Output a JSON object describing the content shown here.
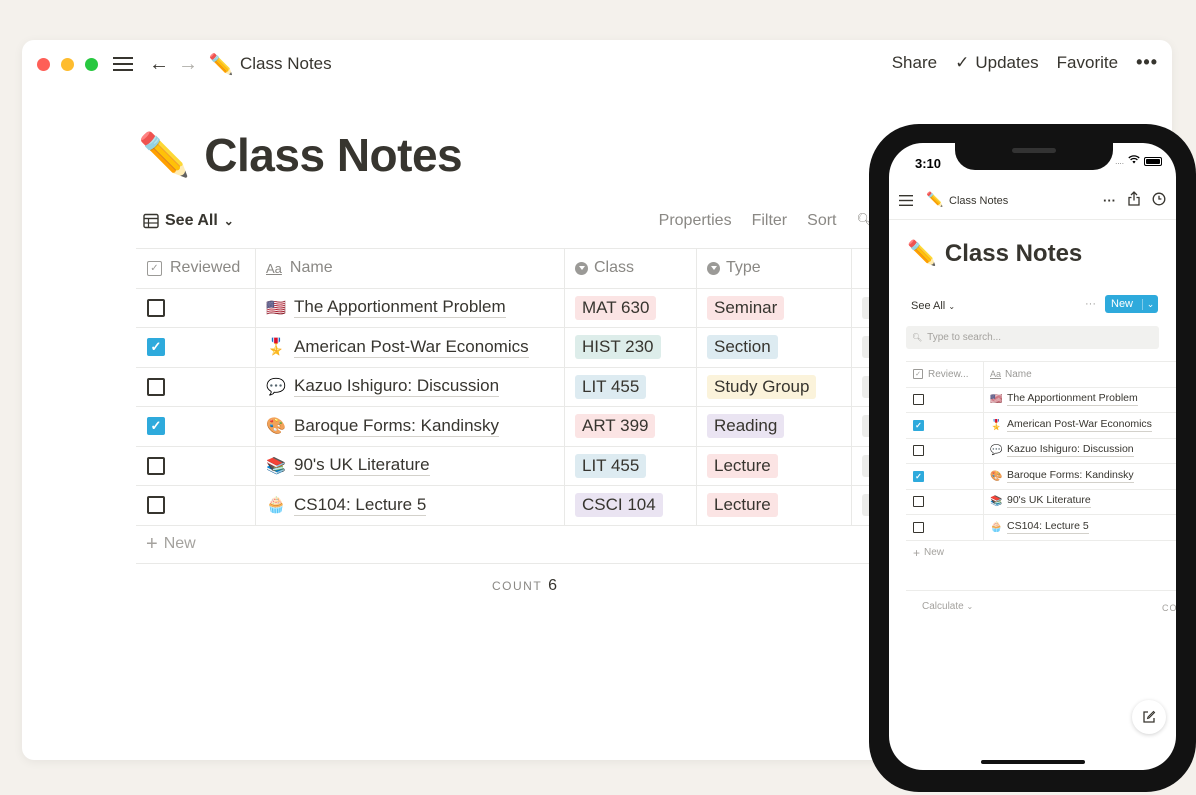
{
  "desktop": {
    "breadcrumb_emoji": "✏️",
    "breadcrumb_title": "Class Notes",
    "actions": {
      "share": "Share",
      "updates": "Updates",
      "favorite": "Favorite",
      "more": "•••"
    },
    "page_emoji": "✏️",
    "page_title": "Class Notes",
    "view": {
      "label": "See All",
      "properties": "Properties",
      "filter": "Filter",
      "sort": "Sort"
    },
    "columns": {
      "reviewed": "Reviewed",
      "name": "Name",
      "class": "Class",
      "type": "Type",
      "name_icon": "Aa"
    },
    "rows": [
      {
        "reviewed": false,
        "emoji": "🇺🇸",
        "name": "The Apportionment Problem",
        "class": "MAT 630",
        "class_color": "#fbe4e4",
        "type": "Seminar",
        "type_color": "#fbe4e4"
      },
      {
        "reviewed": true,
        "emoji": "🎖️",
        "name": "American Post-War Economics",
        "class": "HIST 230",
        "class_color": "#ddedea",
        "type": "Section",
        "type_color": "#ddebf1"
      },
      {
        "reviewed": false,
        "emoji": "💬",
        "name": "Kazuo Ishiguro: Discussion",
        "class": "LIT 455",
        "class_color": "#ddebf1",
        "type": "Study Group",
        "type_color": "#fbf3db"
      },
      {
        "reviewed": true,
        "emoji": "🎨",
        "name": "Baroque Forms: Kandinsky",
        "class": "ART 399",
        "class_color": "#fbe4e4",
        "type": "Reading",
        "type_color": "#eae4f2"
      },
      {
        "reviewed": false,
        "emoji": "📚",
        "name": "90's UK Literature",
        "class": "LIT 455",
        "class_color": "#ddebf1",
        "type": "Lecture",
        "type_color": "#fbe4e4"
      },
      {
        "reviewed": false,
        "emoji": "🧁",
        "name": "CS104: Lecture 5",
        "class": "CSCI 104",
        "class_color": "#eae4f2",
        "type": "Lecture",
        "type_color": "#fbe4e4"
      }
    ],
    "new_label": "New",
    "count_label": "COUNT",
    "count_value": "6"
  },
  "mobile": {
    "time": "3:10",
    "breadcrumb_emoji": "✏️",
    "breadcrumb_title": "Class Notes",
    "page_emoji": "✏️",
    "page_title": "Class Notes",
    "view_label": "See All",
    "more": "···",
    "new_button": "New",
    "search_placeholder": "Type to search...",
    "columns": {
      "reviewed": "Review...",
      "name": "Name",
      "name_icon": "Aa"
    },
    "rows": [
      {
        "reviewed": false,
        "emoji": "🇺🇸",
        "name": "The Apportionment Problem"
      },
      {
        "reviewed": true,
        "emoji": "🎖️",
        "name": "American Post-War Economics"
      },
      {
        "reviewed": false,
        "emoji": "💬",
        "name": "Kazuo Ishiguro: Discussion"
      },
      {
        "reviewed": true,
        "emoji": "🎨",
        "name": "Baroque Forms: Kandinsky"
      },
      {
        "reviewed": false,
        "emoji": "📚",
        "name": "90's UK Literature"
      },
      {
        "reviewed": false,
        "emoji": "🧁",
        "name": "CS104: Lecture 5"
      }
    ],
    "new_label": "New",
    "calculate": "Calculate",
    "count_truncated": "CO"
  },
  "colors": {
    "accent": "#2eaadc",
    "text": "#37352f",
    "muted": "#8a8884"
  },
  "icons": [
    "menu-icon",
    "back-arrow-icon",
    "forward-arrow-icon",
    "checkmark-icon",
    "table-icon",
    "search-icon",
    "share-icon",
    "clock-icon",
    "compose-icon"
  ]
}
